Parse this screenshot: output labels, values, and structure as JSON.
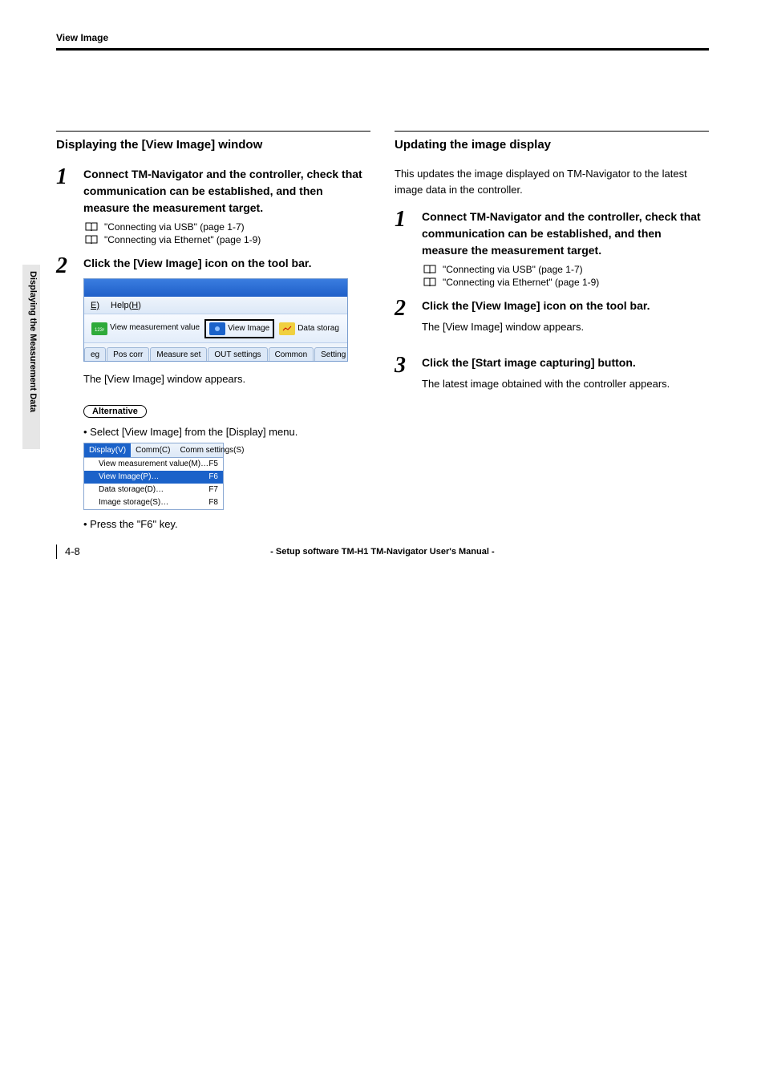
{
  "header": {
    "page_title": "View Image"
  },
  "side_tab": "Displaying the Measurement Data",
  "left": {
    "heading": "Displaying the [View Image] window",
    "step1": {
      "num": "1",
      "title": "Connect TM-Navigator and the controller, check that communication can be established, and then measure the measurement target.",
      "ref1": "\"Connecting via USB\" (page 1-7)",
      "ref2": "\"Connecting via Ethernet\" (page 1-9)"
    },
    "step2": {
      "num": "2",
      "title": "Click the [View Image] icon on the tool bar."
    },
    "toolbar": {
      "menu_e": "E)",
      "menu_help": "Help(",
      "menu_help_u": "H",
      "menu_help_close": ")",
      "btn1": "View measurement value",
      "btn2": "View Image",
      "btn3": "Data storag",
      "tabs": {
        "t0": "eg",
        "t1": "Pos corr",
        "t2": "Measure set",
        "t3": "OUT settings",
        "t4": "Common",
        "t5": "Setting list"
      }
    },
    "after_toolbar": "The [View Image] window appears.",
    "alternative_label": "Alternative",
    "alt_line1": "• Select [View Image] from the [Display] menu.",
    "menu": {
      "top1": "Display(V)",
      "top2": "Comm(C)",
      "top3": "Comm settings(S)",
      "row1_l": "View measurement value(M)…",
      "row1_r": "F5",
      "row2_l": "View Image(P)…",
      "row2_r": "F6",
      "row3_l": "Data storage(D)…",
      "row3_r": "F7",
      "row4_l": "Image storage(S)…",
      "row4_r": "F8"
    },
    "alt_line2": "• Press the \"F6\" key."
  },
  "right": {
    "heading": "Updating the image display",
    "intro": "This updates the image displayed on TM-Navigator to the latest image data in the controller.",
    "step1": {
      "num": "1",
      "title": "Connect TM-Navigator and the controller, check that communication can be established, and then measure the measurement target.",
      "ref1": "\"Connecting via USB\" (page 1-7)",
      "ref2": "\"Connecting via Ethernet\" (page 1-9)"
    },
    "step2": {
      "num": "2",
      "title": "Click the [View Image] icon on the tool bar.",
      "desc": "The [View Image] window appears."
    },
    "step3": {
      "num": "3",
      "title": "Click the [Start image capturing] button.",
      "desc": "The latest image obtained with the controller appears."
    }
  },
  "footer": {
    "page": "4-8",
    "title": "- Setup software TM-H1 TM-Navigator User's Manual -"
  }
}
